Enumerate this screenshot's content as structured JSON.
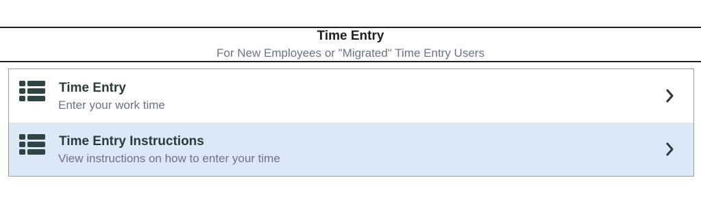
{
  "header": {
    "title": "Time Entry",
    "subtitle": "For New Employees or \"Migrated\" Time Entry Users"
  },
  "items": [
    {
      "title": "Time Entry",
      "description": "Enter your work time",
      "icon": "list-icon",
      "action_icon": "chevron-right-icon"
    },
    {
      "title": "Time Entry Instructions",
      "description": "View instructions on how to enter your time",
      "icon": "list-icon",
      "action_icon": "chevron-right-icon"
    }
  ],
  "colors": {
    "text_dark": "#2b3a3a",
    "text_muted": "#6b7380",
    "highlight": "#dce7f7",
    "border": "#9a9a9a"
  }
}
